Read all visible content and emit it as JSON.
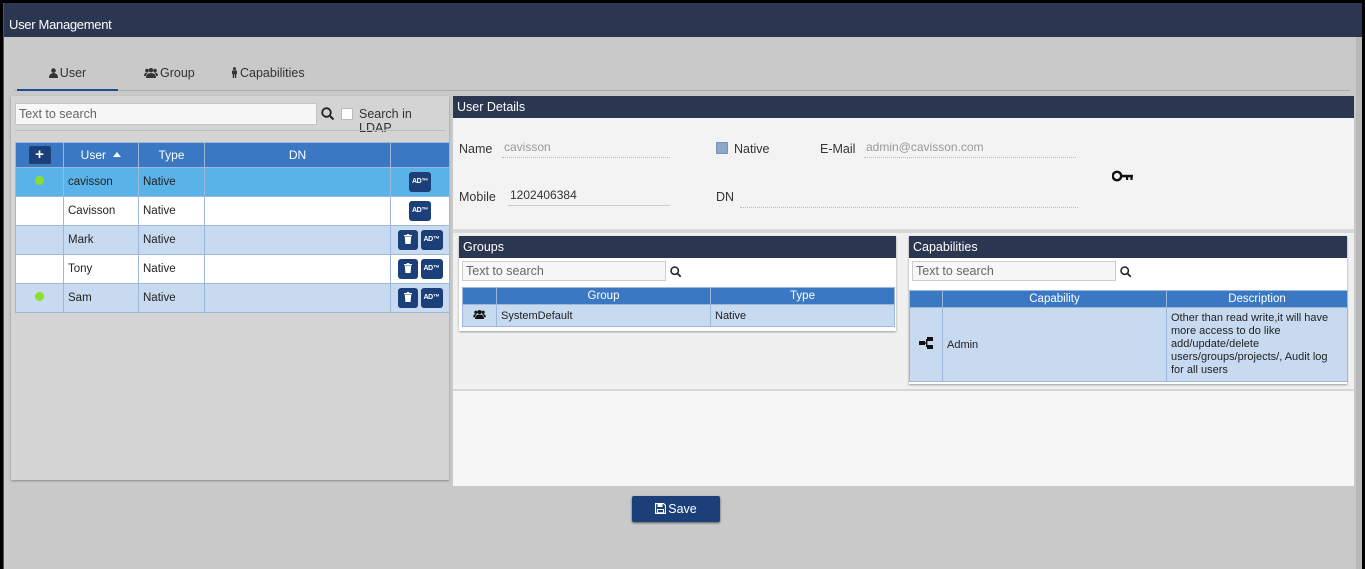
{
  "window": {
    "title": "User Management"
  },
  "tabs": [
    {
      "label": "User",
      "icon": "user-icon",
      "active": true
    },
    {
      "label": "Group",
      "icon": "users-icon",
      "active": false
    },
    {
      "label": "Capabilities",
      "icon": "person-icon",
      "active": false
    }
  ],
  "user_list": {
    "search_placeholder": "Text to search",
    "ldap_label": "Search in LDAP",
    "add_label": "+",
    "columns": {
      "user": "User",
      "type": "Type",
      "dn": "DN"
    },
    "rows": [
      {
        "user": "cavisson",
        "type": "Native",
        "dn": "",
        "online": true,
        "deletable": false
      },
      {
        "user": "Cavisson",
        "type": "Native",
        "dn": "",
        "online": false,
        "deletable": false
      },
      {
        "user": "Mark",
        "type": "Native",
        "dn": "",
        "online": false,
        "deletable": true
      },
      {
        "user": "Tony",
        "type": "Native",
        "dn": "",
        "online": false,
        "deletable": true
      },
      {
        "user": "Sam",
        "type": "Native",
        "dn": "",
        "online": true,
        "deletable": true
      }
    ],
    "ad_label": "AD™"
  },
  "user_details": {
    "header": "User Details",
    "name_label": "Name",
    "name_value": "cavisson",
    "native_label": "Native",
    "native_checked": true,
    "email_label": "E-Mail",
    "email_value": "admin@cavisson.com",
    "mobile_label": "Mobile",
    "mobile_value": "1202406384",
    "dn_label": "DN",
    "dn_value": ""
  },
  "groups": {
    "header": "Groups",
    "search_placeholder": "Text to search",
    "columns": {
      "group": "Group",
      "type": "Type"
    },
    "rows": [
      {
        "group": "SystemDefault",
        "type": "Native"
      }
    ]
  },
  "capabilities": {
    "header": "Capabilities",
    "search_placeholder": "Text to search",
    "columns": {
      "capability": "Capability",
      "description": "Description"
    },
    "rows": [
      {
        "capability": "Admin",
        "description": "Other than read write,it will have more access to do like add/update/delete users/groups/projects/, Audit log for all users"
      }
    ]
  },
  "save_label": "Save",
  "colors": {
    "header": "#2b3650",
    "accent": "#3a78c4",
    "button": "#1b3f78",
    "selected_row": "#5ab3e8",
    "online_dot": "#8cde2a"
  }
}
